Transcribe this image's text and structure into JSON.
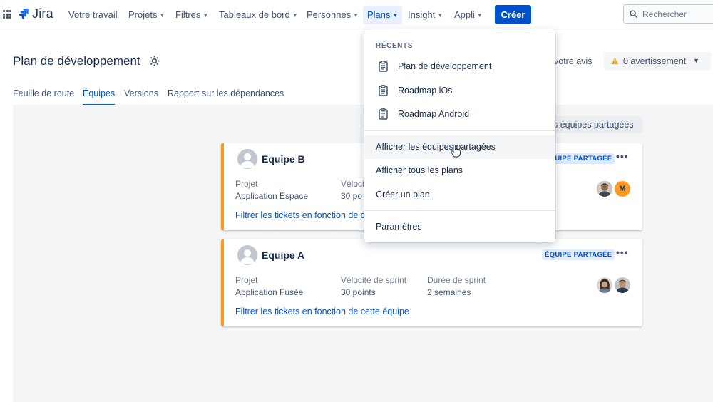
{
  "nav": {
    "logo": "Jira",
    "items": [
      {
        "label": "Votre travail",
        "dropdown": false
      },
      {
        "label": "Projets",
        "dropdown": true
      },
      {
        "label": "Filtres",
        "dropdown": true
      },
      {
        "label": "Tableaux de bord",
        "dropdown": true
      },
      {
        "label": "Personnes",
        "dropdown": true
      },
      {
        "label": "Plans",
        "dropdown": true,
        "active": true
      },
      {
        "label": "Insight",
        "dropdown": true
      },
      {
        "label": "Appli",
        "dropdown": true
      }
    ],
    "create_label": "Créer",
    "search_placeholder": "Rechercher"
  },
  "header": {
    "title": "Plan de développement",
    "feedback": "votre avis",
    "warning": "0 avertissement"
  },
  "tabs": [
    {
      "label": "Feuille de route",
      "active": false
    },
    {
      "label": "Équipes",
      "active": true
    },
    {
      "label": "Versions",
      "active": false
    },
    {
      "label": "Rapport sur les dépendances",
      "active": false
    }
  ],
  "shared_teams_button": "s équipes partagées",
  "teams": [
    {
      "name": "Equipe B",
      "badge": "ÉQUIPE PARTAGÉE",
      "project_label": "Projet",
      "project": "Application Espace",
      "velocity_label": "Vélocit",
      "velocity": "30 po",
      "filter_link": "Filtrer les tickets en fonction de c",
      "member_initial": "M"
    },
    {
      "name": "Equipe A",
      "badge": "ÉQUIPE PARTAGÉE",
      "project_label": "Projet",
      "project": "Application Fusée",
      "velocity_label": "Vélocité de sprint",
      "velocity": "30 points",
      "duration_label": "Durée de sprint",
      "duration": "2 semaines",
      "filter_link": "Filtrer les tickets en fonction de cette équipe"
    }
  ],
  "dropdown": {
    "recent_heading": "RÉCENTS",
    "recent": [
      {
        "label": "Plan de développement"
      },
      {
        "label": "Roadmap iOs"
      },
      {
        "label": "Roadmap Android"
      }
    ],
    "actions": [
      {
        "label": "Afficher les équipes partagées",
        "hover": true
      },
      {
        "label": "Afficher tous les plans"
      },
      {
        "label": "Créer un plan"
      }
    ],
    "settings": "Paramètres"
  },
  "colors": {
    "accent": "#0052cc",
    "team_border": "#ff991f",
    "warning": "#ffab00"
  }
}
